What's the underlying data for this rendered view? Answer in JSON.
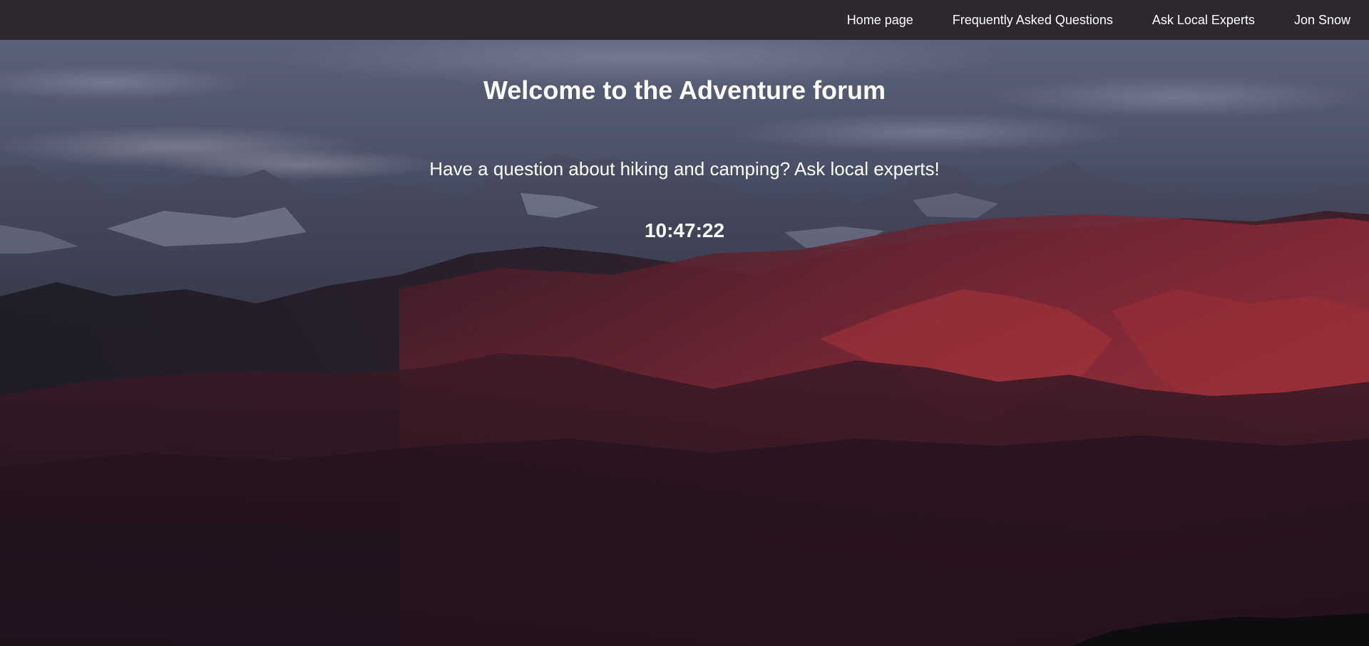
{
  "nav": {
    "links": [
      {
        "label": "Home page"
      },
      {
        "label": "Frequently Asked Questions"
      },
      {
        "label": "Ask Local Experts"
      },
      {
        "label": "Jon Snow"
      }
    ]
  },
  "hero": {
    "title": "Welcome to the Adventure forum",
    "subtitle": "Have a question about hiking and camping? Ask local experts!",
    "clock": "10:47:22"
  },
  "colors": {
    "navbar_bg": "#2d282f",
    "text": "#ffffff",
    "sky": "#4b5268",
    "mountain_red": "#8a2a38"
  }
}
